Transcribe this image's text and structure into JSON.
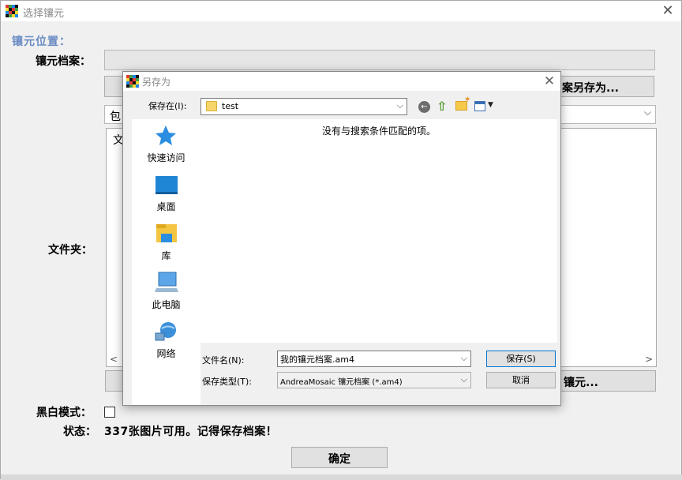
{
  "main_window": {
    "title": "选择镶元",
    "close_glyph": "✕",
    "section_title": "镶元位置：",
    "mosaic_file_label": "镶元档案：",
    "mosaic_file_value": "",
    "save_as_button_label": "案另存为...",
    "include_dropdown_value": "包",
    "folder_list_visible_text": "文",
    "folder_label": "文件夹：",
    "add_mosaic_button_label": "镶元...",
    "bw_mode_label": "黑白模式：",
    "bw_mode_checked": false,
    "status_label": "状态：",
    "status_value": "337张图片可用。记得保存档案！",
    "ok_button_label": "确定"
  },
  "save_dialog": {
    "title": "另存为",
    "close_glyph": "✕",
    "save_in_label": "保存在(I):",
    "save_in_value": "test",
    "toolbar_icons": [
      "back-icon",
      "up-folder-icon",
      "new-folder-icon",
      "view-menu-icon"
    ],
    "places": [
      {
        "label": "快速访问",
        "icon": "quick-access-star-icon"
      },
      {
        "label": "桌面",
        "icon": "desktop-icon"
      },
      {
        "label": "库",
        "icon": "libraries-icon"
      },
      {
        "label": "此电脑",
        "icon": "this-pc-icon"
      },
      {
        "label": "网络",
        "icon": "network-icon"
      }
    ],
    "empty_message": "没有与搜索条件匹配的项。",
    "filename_label": "文件名(N):",
    "filename_value": "我的镶元档案.am4",
    "filetype_label": "保存类型(T):",
    "filetype_value": "AndreaMosaic 镶元档案 (*.am4)",
    "save_button_label": "保存(S)",
    "cancel_button_label": "取消"
  },
  "colors": {
    "accent_blue": "#6b8cc4",
    "folder_yellow": "#f6d56b",
    "default_button_border": "#0078d7"
  }
}
